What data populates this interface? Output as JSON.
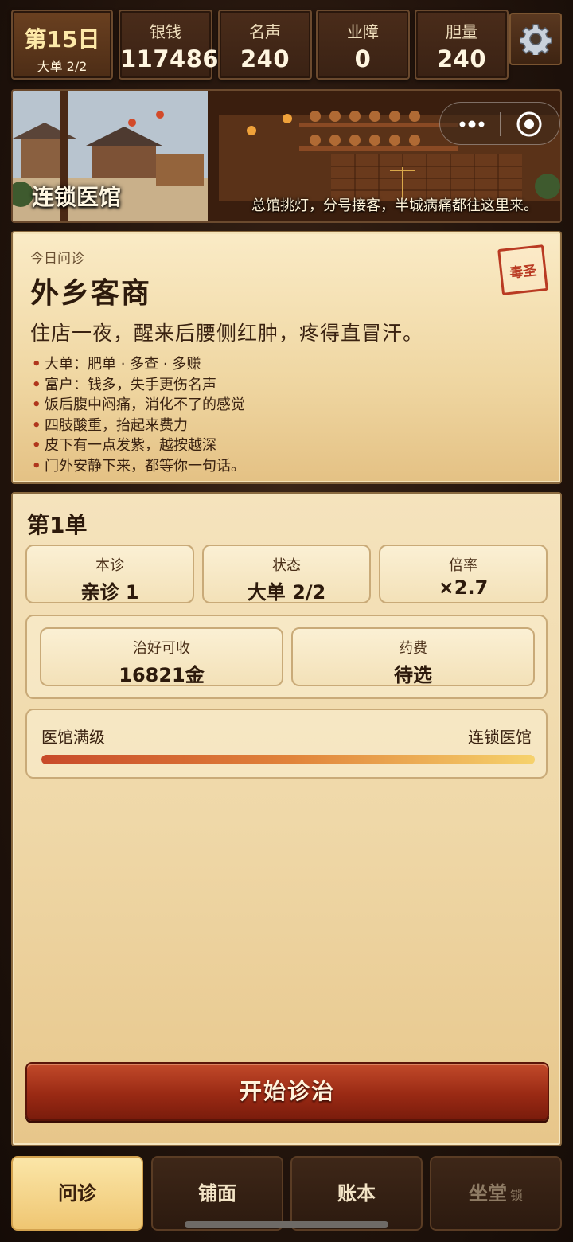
{
  "header": {
    "day": "第15日",
    "day_sub": "大单 2/2",
    "stats": [
      {
        "label": "银钱",
        "value": "117486"
      },
      {
        "label": "名声",
        "value": "240"
      },
      {
        "label": "业障",
        "value": "0"
      },
      {
        "label": "胆量",
        "value": "240"
      }
    ],
    "settings_icon": "gear-icon"
  },
  "banner": {
    "title": "连锁医馆",
    "caption": "总馆挑灯，分号接客，半城病痛都往这里来。",
    "capsule_icons": [
      "more-dots-icon",
      "target-icon"
    ]
  },
  "patient": {
    "tag": "今日问诊",
    "name": "外乡客商",
    "seal": "毒圣",
    "description": "住店一夜，醒来后腰侧红肿，疼得直冒汗。",
    "traits": [
      "大单：肥单 · 多查 · 多赚",
      "富户：钱多，失手更伤名声",
      "饭后腹中闷痛，消化不了的感觉",
      "四肢酸重，抬起来费力",
      "皮下有一点发紫，越按越深",
      "门外安静下来，都等你一句话。"
    ]
  },
  "order": {
    "title": "第1单",
    "cells": [
      {
        "label": "本诊",
        "value": "亲诊 1"
      },
      {
        "label": "状态",
        "value": "大单 2/2"
      },
      {
        "label": "倍率",
        "value": "×2.7"
      }
    ],
    "fees": [
      {
        "label": "治好可收",
        "value": "16821金"
      },
      {
        "label": "药费",
        "value": "待选"
      }
    ],
    "level": {
      "left": "医馆满级",
      "right": "连锁医馆",
      "progress": 1.0
    },
    "start_button": "开始诊治"
  },
  "tabs": [
    {
      "label": "问诊",
      "active": true
    },
    {
      "label": "铺面",
      "active": false
    },
    {
      "label": "账本",
      "active": false
    },
    {
      "label": "坐堂",
      "active": false,
      "lock": "锁"
    }
  ],
  "colors": {
    "accent_red": "#9a2a14",
    "gold": "#efc672",
    "parchment": "#f5e3bd",
    "dark_wood": "#2c1a0f"
  }
}
